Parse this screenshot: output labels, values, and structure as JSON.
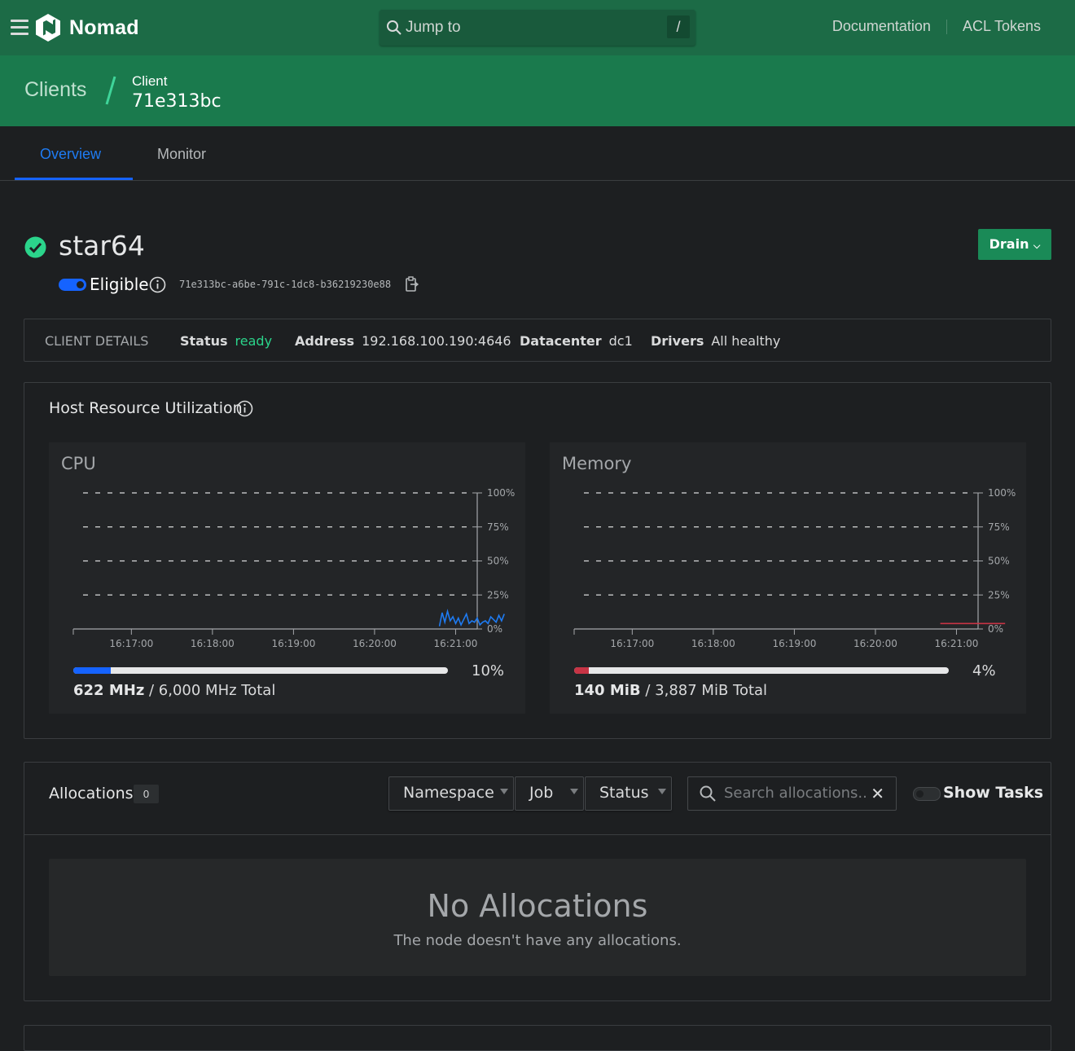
{
  "topbar": {
    "brand": "Nomad",
    "search_placeholder": "Jump to",
    "search_shortcut": "/",
    "links": [
      "Documentation",
      "ACL Tokens"
    ]
  },
  "breadcrumb": {
    "parent": "Clients",
    "current_label": "Client",
    "current_value": "71e313bc"
  },
  "tabs": [
    "Overview",
    "Monitor"
  ],
  "node": {
    "name": "star64",
    "drain_label": "Drain",
    "eligible_label": "Eligible",
    "id": "71e313bc-a6be-791c-1dc8-b36219230e88"
  },
  "client_details": {
    "heading": "CLIENT DETAILS",
    "status_label": "Status",
    "status_value": "ready",
    "address_label": "Address",
    "address_value": "192.168.100.190:4646",
    "datacenter_label": "Datacenter",
    "datacenter_value": "dc1",
    "drivers_label": "Drivers",
    "drivers_value": "All healthy"
  },
  "host_resources": {
    "title": "Host Resource Utilization",
    "cpu": {
      "title": "CPU",
      "percent_label": "10%",
      "percent": 0.1,
      "used": "622 MHz",
      "total": " / 6,000 MHz Total",
      "color": "#1563ff"
    },
    "memory": {
      "title": "Memory",
      "percent_label": "4%",
      "percent": 0.04,
      "used": "140 MiB",
      "total": " / 3,887 MiB Total",
      "color": "#c73445"
    }
  },
  "chart_data": [
    {
      "type": "line",
      "title": "CPU",
      "x_ticks": [
        "16:17:00",
        "16:18:00",
        "16:19:00",
        "16:20:00",
        "16:21:00"
      ],
      "y_ticks": [
        "0%",
        "25%",
        "50%",
        "75%",
        "100%"
      ],
      "ylim": [
        0,
        100
      ],
      "grid": true,
      "series": [
        {
          "x": [
            "16:20:48",
            "16:20:50",
            "16:20:52",
            "16:20:54",
            "16:20:56",
            "16:20:58",
            "16:21:00",
            "16:21:02",
            "16:21:04",
            "16:21:06",
            "16:21:08",
            "16:21:10",
            "16:21:12",
            "16:21:14",
            "16:21:16",
            "16:21:18",
            "16:21:20",
            "16:21:22",
            "16:21:24",
            "16:21:26",
            "16:21:28",
            "16:21:30",
            "16:21:32",
            "16:21:34",
            "16:21:36"
          ],
          "values": [
            2,
            12,
            5,
            13,
            6,
            9,
            4,
            8,
            3,
            7,
            11,
            4,
            6,
            5,
            8,
            3,
            5,
            6,
            4,
            9,
            7,
            5,
            10,
            6,
            11
          ]
        }
      ]
    },
    {
      "type": "line",
      "title": "Memory",
      "x_ticks": [
        "16:17:00",
        "16:18:00",
        "16:19:00",
        "16:20:00",
        "16:21:00"
      ],
      "y_ticks": [
        "0%",
        "25%",
        "50%",
        "75%",
        "100%"
      ],
      "ylim": [
        0,
        100
      ],
      "grid": true,
      "series": [
        {
          "x": [
            "16:20:48",
            "16:21:36"
          ],
          "values": [
            4,
            4
          ]
        }
      ]
    }
  ],
  "allocations": {
    "title": "Allocations",
    "count": "0",
    "filters": [
      "Namespace",
      "Job",
      "Status"
    ],
    "search_placeholder": "Search allocations...",
    "show_tasks_label": "Show Tasks",
    "empty_title": "No Allocations",
    "empty_message": "The node doesn't have any allocations."
  }
}
